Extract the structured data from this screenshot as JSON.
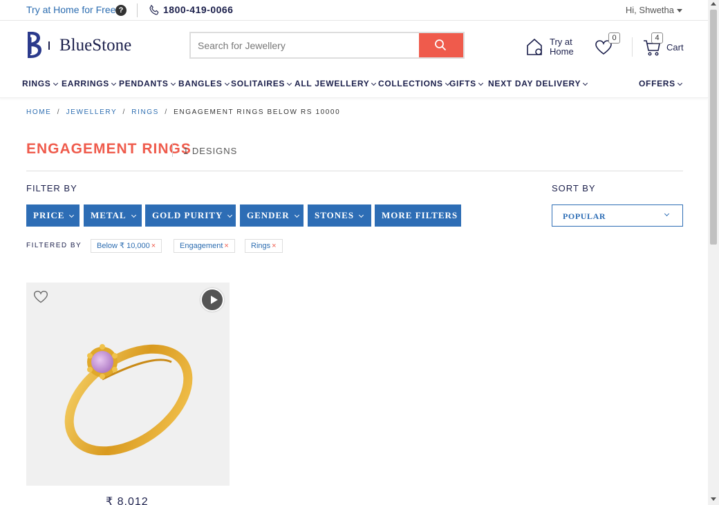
{
  "topbar": {
    "try_home": "Try at Home for Free",
    "help_icon": "?",
    "phone": "1800-419-0066",
    "user": "Hi, Shwetha"
  },
  "header": {
    "logo": "BlueStone",
    "search_placeholder": "Search for Jewellery",
    "try_at_home": "Try at Home",
    "wishlist_count": "0",
    "cart_count": "4",
    "cart_label": "Cart"
  },
  "nav": {
    "items": [
      "RINGS",
      "EARRINGS",
      "PENDANTS",
      "BANGLES",
      "SOLITAIRES",
      "ALL JEWELLERY",
      "COLLECTIONS",
      "GIFTS",
      "NEXT DAY DELIVERY",
      "OFFERS"
    ]
  },
  "breadcrumb": {
    "items": [
      "HOME",
      "JEWELLERY",
      "RINGS"
    ],
    "current": "ENGAGEMENT RINGS BELOW RS 10000",
    "separator": "/"
  },
  "page": {
    "title": "ENGAGEMENT RINGS",
    "designs": "1 DESIGNS",
    "filter_by": "FILTER BY",
    "sort_by": "SORT BY",
    "filtered_by": "FILTERED BY"
  },
  "filters": [
    "PRICE",
    "METAL",
    "GOLD PURITY",
    "GENDER",
    "STONES",
    "MORE FILTERS"
  ],
  "sort": {
    "selected": "POPULAR"
  },
  "chips": [
    {
      "label": "Below ₹ 10,000",
      "remove": "×"
    },
    {
      "label": "Engagement",
      "remove": "×"
    },
    {
      "label": "Rings",
      "remove": "×"
    }
  ],
  "product": {
    "price": "₹ 8,012"
  },
  "colors": {
    "accent": "#ef5b4c",
    "primary": "#2d6db5",
    "navy": "#1b1f4b"
  },
  "icons": [
    "help-icon",
    "phone-icon",
    "search-icon",
    "home-icon",
    "heart-icon",
    "cart-icon",
    "play-icon",
    "wishlist-heart-icon"
  ]
}
